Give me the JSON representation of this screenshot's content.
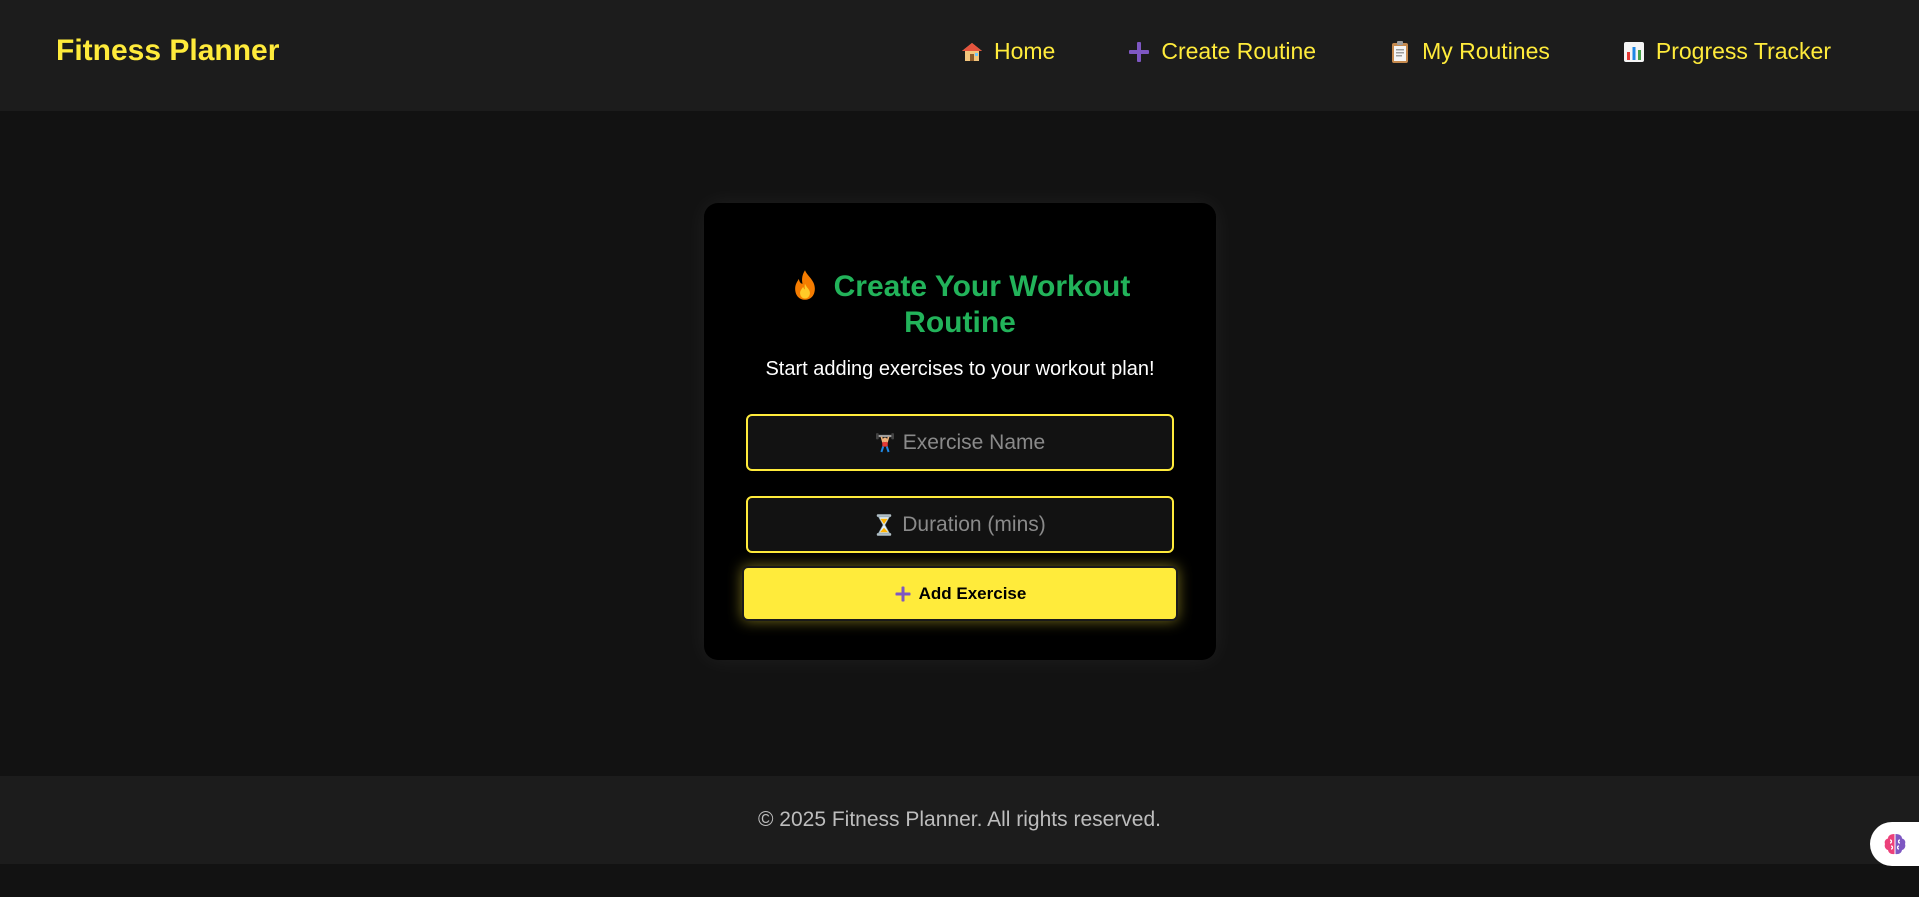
{
  "app": {
    "brand": "Fitness Planner"
  },
  "nav": {
    "items": [
      {
        "label": "Home",
        "icon": "house-icon"
      },
      {
        "label": "Create Routine",
        "icon": "plus-icon"
      },
      {
        "label": "My Routines",
        "icon": "clipboard-icon"
      },
      {
        "label": "Progress Tracker",
        "icon": "bar-chart-icon"
      }
    ]
  },
  "card": {
    "title": "Create Your Workout Routine",
    "title_icon": "fire-icon",
    "subtitle": "Start adding exercises to your workout plan!",
    "exercise_field": {
      "placeholder": "Exercise Name",
      "icon": "weightlifter-icon",
      "value": ""
    },
    "duration_field": {
      "placeholder": "Duration (mins)",
      "icon": "hourglass-icon",
      "value": ""
    },
    "add_button": {
      "label": "Add Exercise",
      "icon": "plus-icon"
    }
  },
  "footer": {
    "text": "© 2025 Fitness Planner. All rights reserved."
  },
  "colors": {
    "accent": "#ffeb3b",
    "title": "#22b35a",
    "background": "#121212",
    "navbar": "#1c1c1c",
    "card": "#000000",
    "plus": "#7e57c2"
  }
}
